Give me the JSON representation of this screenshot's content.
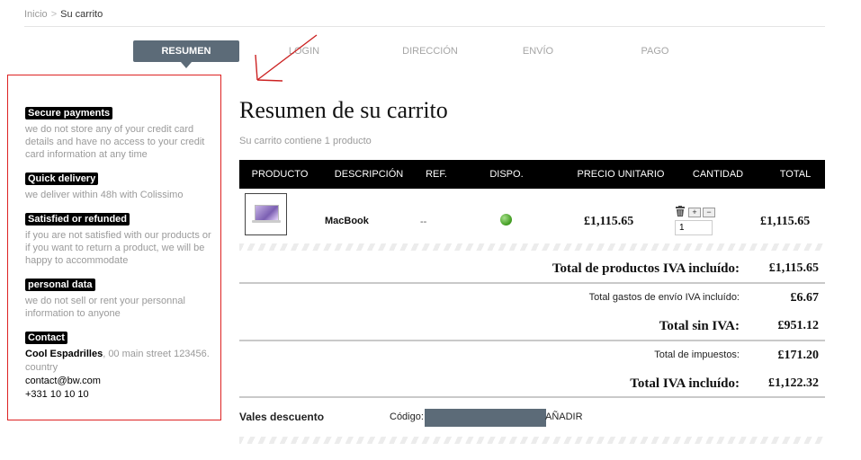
{
  "breadcrumb": {
    "home": "Inicio",
    "separator": ">",
    "current": "Su carrito"
  },
  "steps": [
    "RESUMEN",
    "LOGIN",
    "DIRECCIÓN",
    "ENVÍO",
    "PAGO"
  ],
  "active_step": "RESUMEN",
  "page_title": "Resumen de su carrito",
  "cart_summary": "Su carrito contiene 1 producto",
  "reassurance": {
    "secure": {
      "title": "Secure payments",
      "text": "we do not store any of your credit card details and have no access to your credit card information at any time"
    },
    "delivery": {
      "title": "Quick delivery",
      "text": "we deliver within 48h with Colissimo"
    },
    "refund": {
      "title": "Satisfied or refunded",
      "text": "if you are not satisfied with our products or if you want to return a product, we will be happy to accommodate"
    },
    "personal": {
      "title": "personal data",
      "text": "we do not sell or rent your personnal information to anyone"
    },
    "contact": {
      "title": "Contact",
      "company": "Cool Espadrilles",
      "address": ", 00 main street 123456. country",
      "email": "contact@bw.com",
      "phone": "+331 10 10 10"
    }
  },
  "table": {
    "headers": [
      "PRODUCTO",
      "DESCRIPCIÓN",
      "REF.",
      "DISPO.",
      "PRECIO UNITARIO",
      "CANTIDAD",
      "TOTAL"
    ],
    "row": {
      "description": "MacBook",
      "ref": "--",
      "unit_price": "£1,115.65",
      "quantity": "1",
      "total": "£1,115.65",
      "qty_up": "+",
      "qty_down": "−"
    }
  },
  "totals": {
    "products_label": "Total de productos IVA incluído:",
    "products_value": "£1,115.65",
    "shipping_label": "Total gastos de envío IVA incluído:",
    "shipping_value": "£6.67",
    "excl_label": "Total sin IVA:",
    "excl_value": "£951.12",
    "tax_label": "Total de impuestos:",
    "tax_value": "£171.20",
    "incl_label": "Total IVA incluído:",
    "incl_value": "£1,122.32"
  },
  "voucher": {
    "title": "Vales descuento",
    "code_label": "Código:",
    "add_label": "AÑADIR"
  },
  "colors": {
    "step_active": "#5c6b78",
    "header_bg": "#000000",
    "box_border": "#dd2222",
    "arrow": "#cc2222"
  }
}
